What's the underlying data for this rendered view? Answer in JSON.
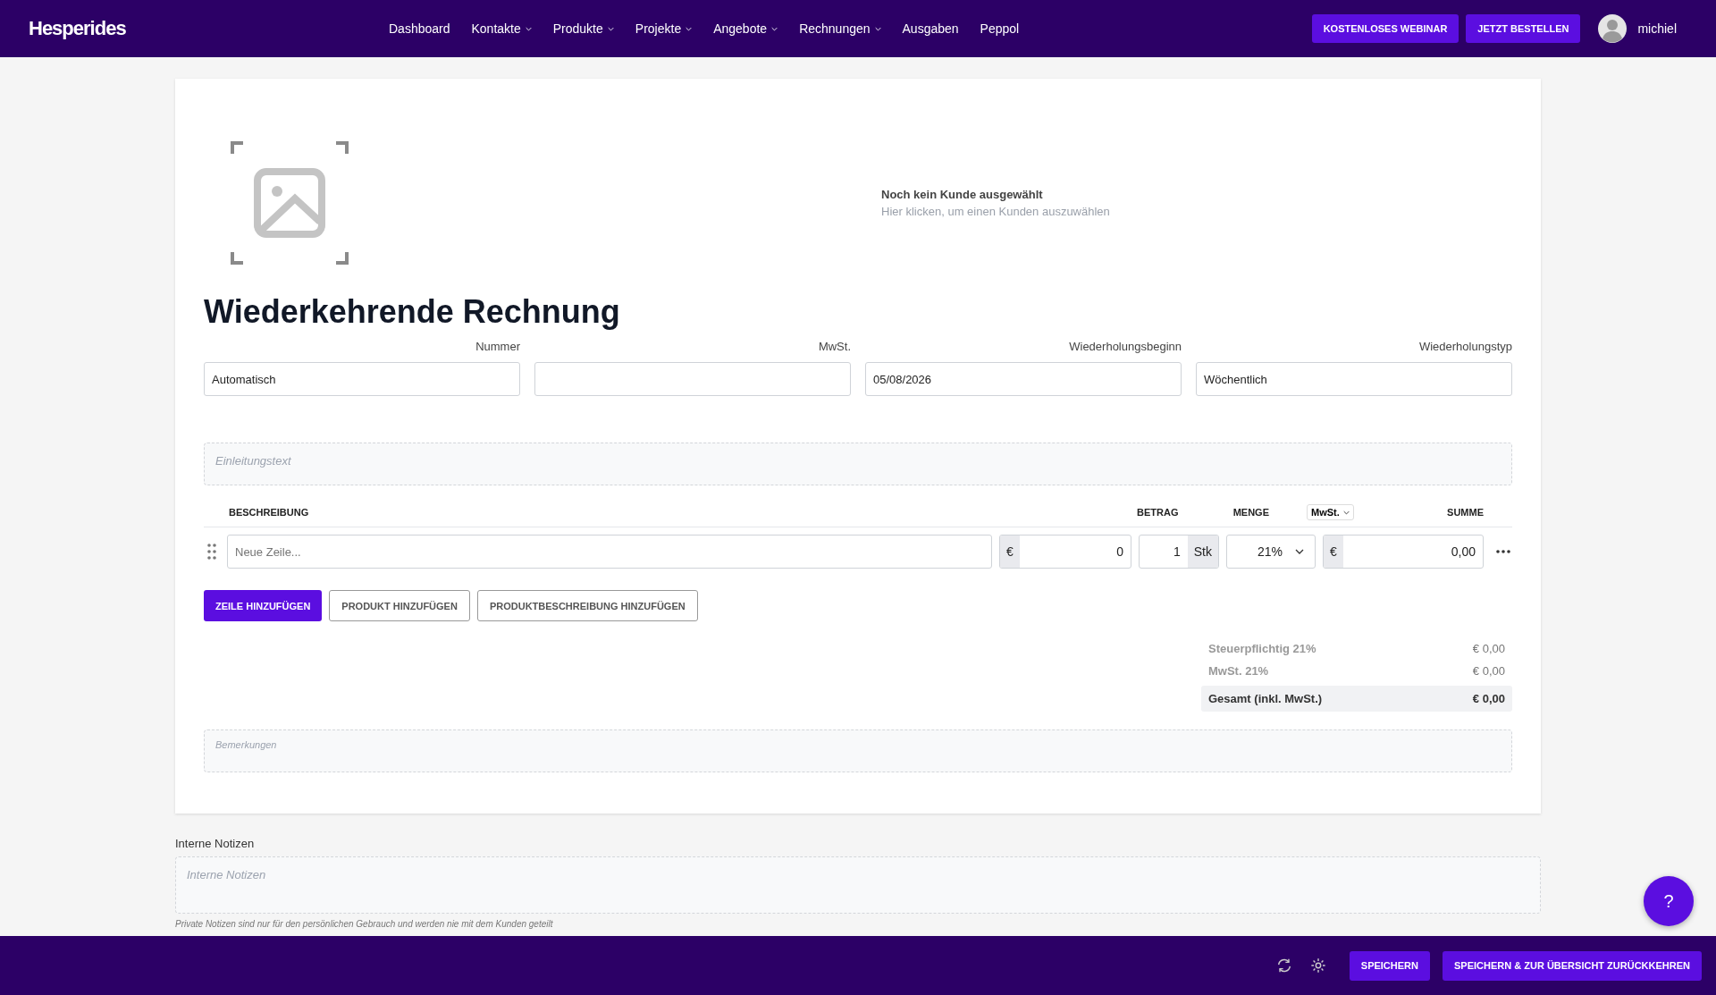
{
  "header": {
    "logo": "Hesperides",
    "nav": [
      {
        "label": "Dashboard",
        "dropdown": false
      },
      {
        "label": "Kontakte",
        "dropdown": true
      },
      {
        "label": "Produkte",
        "dropdown": true
      },
      {
        "label": "Projekte",
        "dropdown": true
      },
      {
        "label": "Angebote",
        "dropdown": true
      },
      {
        "label": "Rechnungen",
        "dropdown": true
      },
      {
        "label": "Ausgaben",
        "dropdown": false
      },
      {
        "label": "Peppol",
        "dropdown": false
      }
    ],
    "buttons": [
      "KOSTENLOSES WEBINAR",
      "JETZT BESTELLEN"
    ],
    "user": "michiel"
  },
  "customer": {
    "title": "Noch kein Kunde ausgewählt",
    "hint": "Hier klicken, um einen Kunden auszuwählen"
  },
  "title": "Wiederkehrende Rechnung",
  "fields": [
    {
      "label": "Nummer",
      "value": "Automatisch"
    },
    {
      "label": "MwSt."
    },
    {
      "label": "Wiederholungsbeginn",
      "value": "05/08/2026"
    },
    {
      "label": "Wiederholungstyp",
      "value": "Wöchentlich"
    }
  ],
  "intro": {
    "placeholder": "Einleitungstext"
  },
  "table": {
    "columns": [
      "BESCHREIBUNG",
      "BETRAG",
      "MENGE",
      "MwSt.",
      "SUMME"
    ],
    "row": {
      "placeholder": "Neue Zeile...",
      "currency": "€",
      "amount": "0",
      "quantity": "1",
      "unit": "Stk",
      "vat": "21%",
      "sum_currency": "€",
      "sum": "0,00"
    }
  },
  "actions": [
    {
      "label": "ZEILE HINZUFÜGEN",
      "kind": "primary"
    },
    {
      "label": "PRODUKT HINZUFÜGEN",
      "kind": "outline"
    },
    {
      "label": "PRODUKTBESCHREIBUNG HINZUFÜGEN",
      "kind": "outline"
    }
  ],
  "totals": [
    {
      "label": "Steuerpflichtig 21%",
      "value": "€ 0,00",
      "kind": "line"
    },
    {
      "label": "MwSt. 21%",
      "value": "€ 0,00",
      "kind": "line"
    },
    {
      "label": "Gesamt (inkl. MwSt.)",
      "value": "€ 0,00",
      "kind": "total"
    }
  ],
  "remarks": {
    "placeholder": "Bemerkungen"
  },
  "notes": {
    "label": "Interne Notizen",
    "placeholder": "Interne Notizen",
    "hint": "Private Notizen sind nur für den persönlichen Gebrauch und werden nie mit dem Kunden geteilt"
  },
  "help": "?",
  "footer": {
    "buttons": [
      "SPEICHERN",
      "SPEICHERN & ZUR ÜBERSICHT ZURÜCKKEHREN"
    ]
  }
}
